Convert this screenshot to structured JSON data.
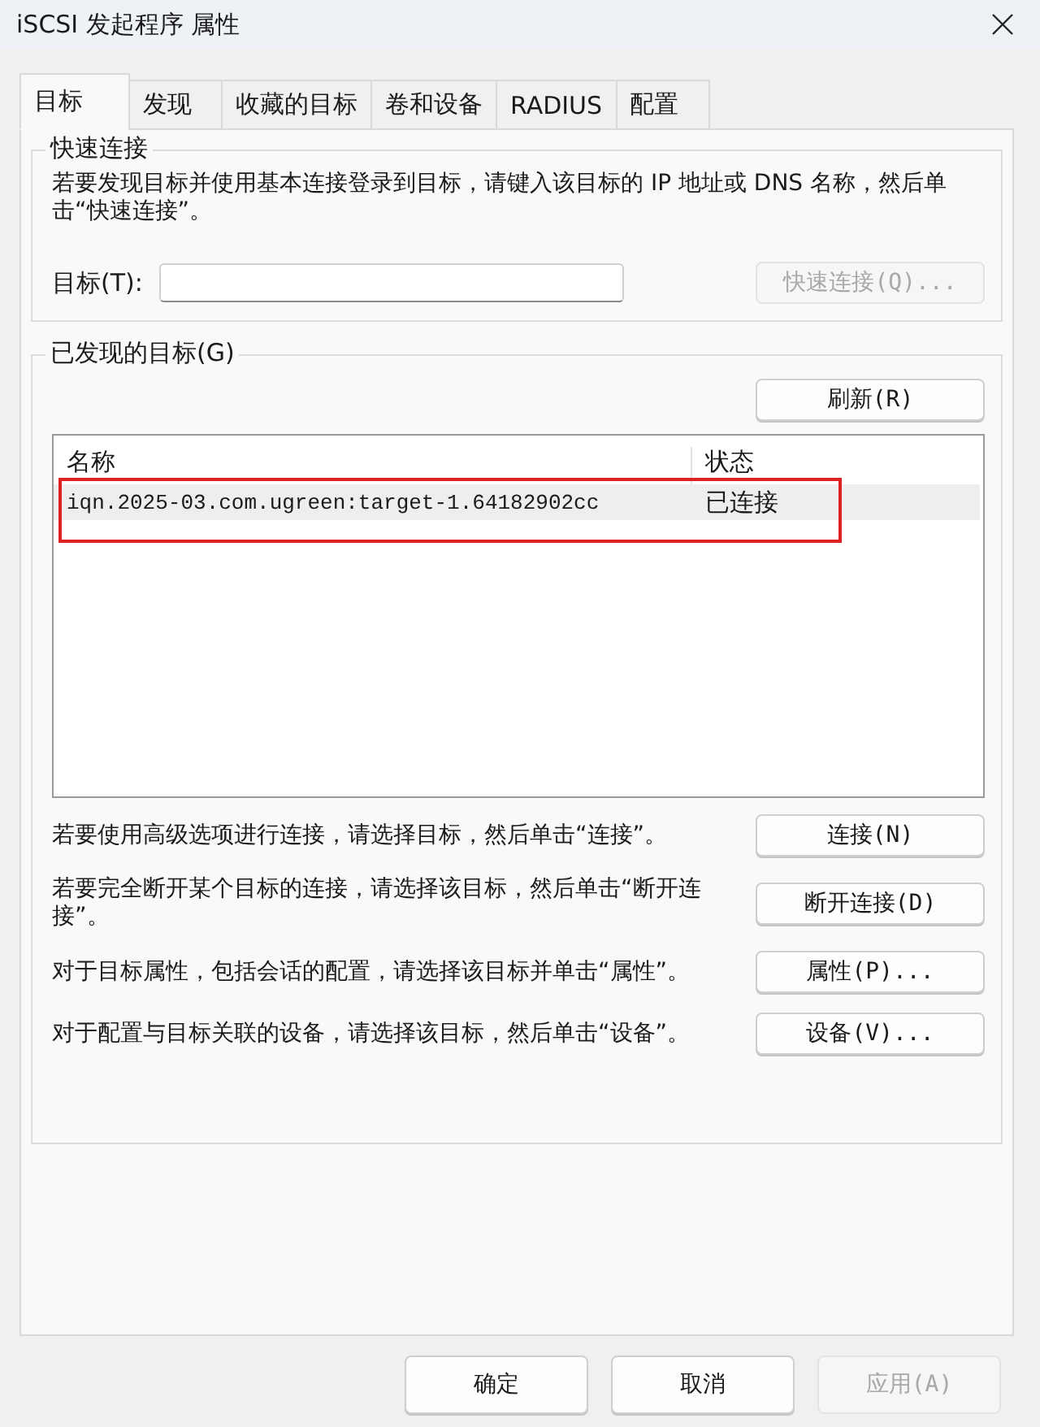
{
  "window": {
    "title": "iSCSI 发起程序 属性"
  },
  "tabs": [
    {
      "label": "目标",
      "selected": true
    },
    {
      "label": "发现",
      "selected": false
    },
    {
      "label": "收藏的目标",
      "selected": false
    },
    {
      "label": "卷和设备",
      "selected": false
    },
    {
      "label": "RADIUS",
      "selected": false
    },
    {
      "label": "配置",
      "selected": false
    }
  ],
  "quick_connect": {
    "title": "快速连接",
    "description": "若要发现目标并使用基本连接登录到目标，请键入该目标的 IP 地址或 DNS 名称，然后单击“快速连接”。",
    "target_label": "目标(T):",
    "button": {
      "label": "快速连接(Q)...",
      "disabled": true
    }
  },
  "discovered": {
    "title": "已发现的目标(G)",
    "refresh_button": "刷新(R)",
    "columns": [
      "名称",
      "状态"
    ],
    "rows": [
      {
        "name": "iqn.2025-03.com.ugreen:target-1.64182902cc",
        "status": "已连接",
        "selected": true,
        "annotated": true
      }
    ]
  },
  "actions": [
    {
      "description": "若要使用高级选项进行连接，请选择目标，然后单击“连接”。",
      "button": "连接(N)"
    },
    {
      "description": "若要完全断开某个目标的连接，请选择该目标，然后单击“断开连接”。",
      "button": "断开连接(D)"
    },
    {
      "description": "对于目标属性，包括会话的配置，请选择该目标并单击“属性”。",
      "button": "属性(P)..."
    },
    {
      "description": "对于配置与目标关联的设备，请选择该目标，然后单击“设备”。",
      "button": "设备(V)..."
    }
  ],
  "footer": [
    {
      "label": "确定",
      "disabled": false
    },
    {
      "label": "取消",
      "disabled": false
    },
    {
      "label": "应用(A)",
      "disabled": true
    }
  ]
}
